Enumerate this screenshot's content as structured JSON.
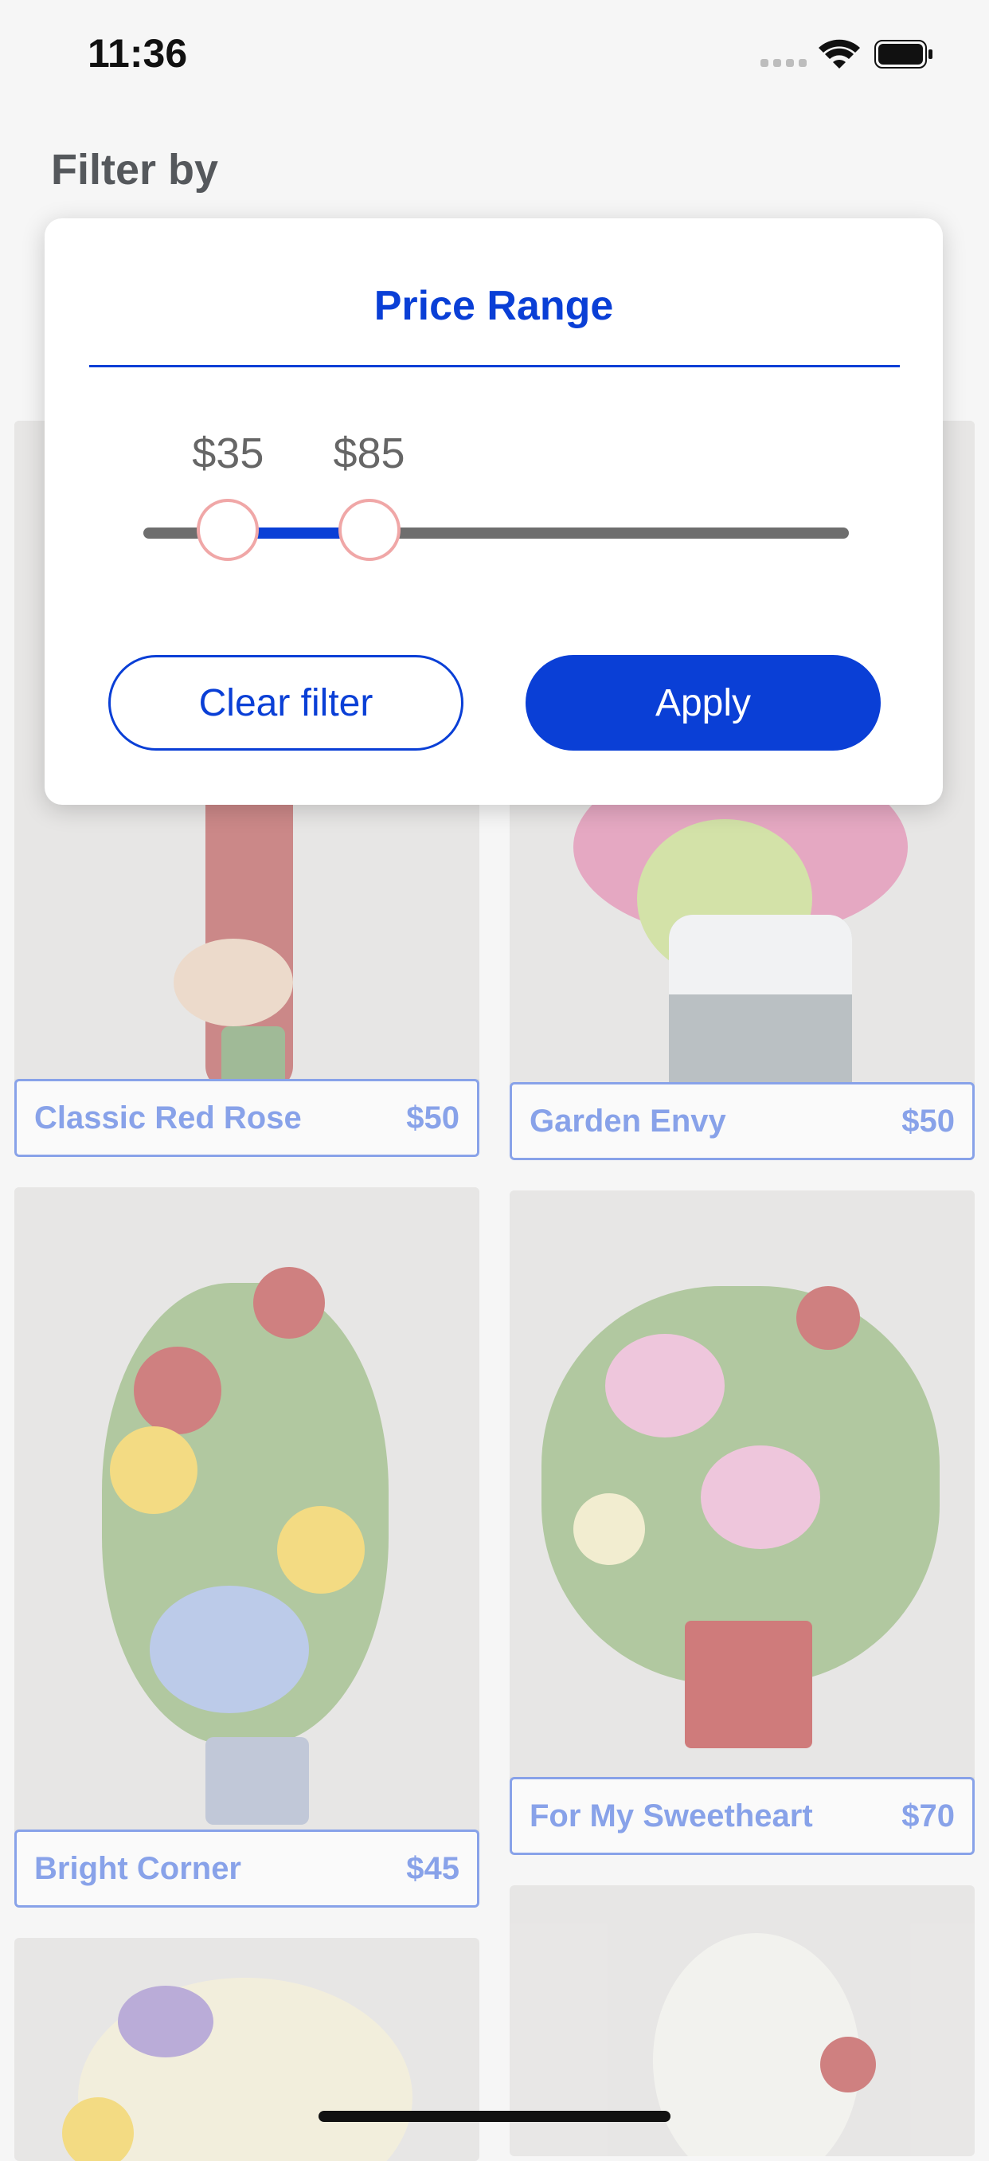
{
  "status": {
    "time": "11:36"
  },
  "header": {
    "title": "Filter by"
  },
  "products": [
    {
      "name": "Classic Red Rose",
      "price": "$50"
    },
    {
      "name": "Garden Envy",
      "price": "$50"
    },
    {
      "name": "Bright Corner",
      "price": "$45"
    },
    {
      "name": "For My Sweetheart",
      "price": "$70"
    }
  ],
  "modal": {
    "title": "Price Range",
    "min_label": "$35",
    "max_label": "$85",
    "min_fraction": 0.12,
    "max_fraction": 0.32,
    "clear_label": "Clear filter",
    "apply_label": "Apply"
  },
  "colors": {
    "accent": "#0a3fd6",
    "thumb_border": "#f0a7a7",
    "track": "#6e6e6e"
  }
}
